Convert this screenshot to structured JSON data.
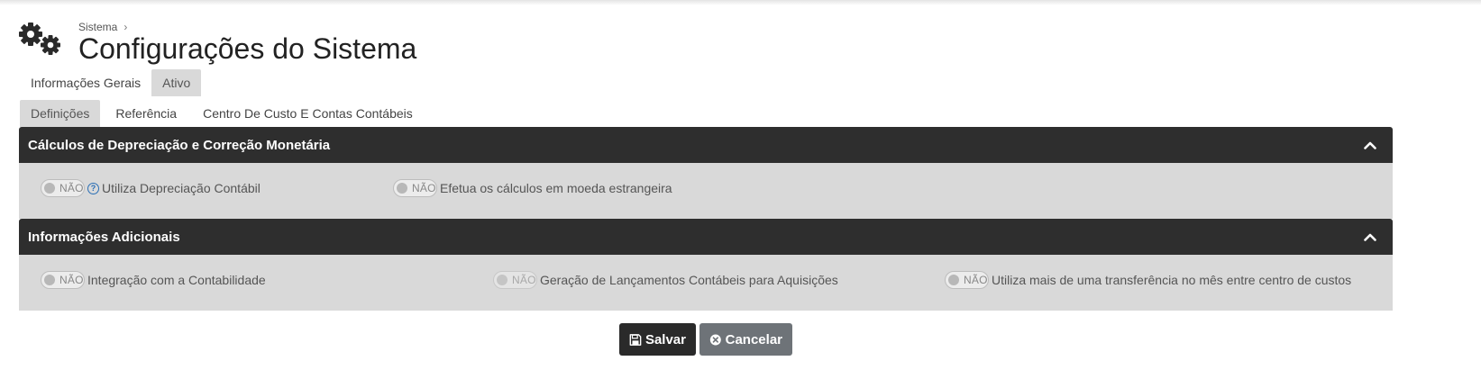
{
  "breadcrumb": {
    "item": "Sistema",
    "separator": "›"
  },
  "page": {
    "title": "Configurações do Sistema",
    "icon": "gears-icon"
  },
  "tabs_primary": [
    {
      "label": "Informações Gerais",
      "active": false
    },
    {
      "label": "Ativo",
      "active": true
    }
  ],
  "tabs_secondary": [
    {
      "label": "Definições",
      "active": true
    },
    {
      "label": "Referência",
      "active": false
    },
    {
      "label": "Centro De Custo E Contas Contábeis",
      "active": false
    }
  ],
  "panels": [
    {
      "title": "Cálculos de Depreciação e Correção Monetária",
      "options": [
        {
          "toggle": "NÃO",
          "label": "Utiliza Depreciação Contábil",
          "help_icon": "?"
        },
        {
          "toggle": "NÃO",
          "label": "Efetua os cálculos em moeda estrangeira"
        }
      ]
    },
    {
      "title": "Informações Adicionais",
      "options": [
        {
          "toggle": "NÃO",
          "label": "Integração com a Contabilidade"
        },
        {
          "toggle": "NÃO",
          "label": "Geração de Lançamentos Contábeis para Aquisições",
          "disabled": true
        },
        {
          "toggle": "NÃO",
          "label": "Utiliza mais de uma transferência no mês entre centro de custos"
        }
      ]
    }
  ],
  "buttons": {
    "save": "Salvar",
    "cancel": "Cancelar"
  },
  "colors": {
    "header": "#2e2e2e",
    "panel_body": "#d9d9d9",
    "save": "#2a2a2a",
    "cancel": "#6e7378",
    "help": "#2b6fb5"
  }
}
